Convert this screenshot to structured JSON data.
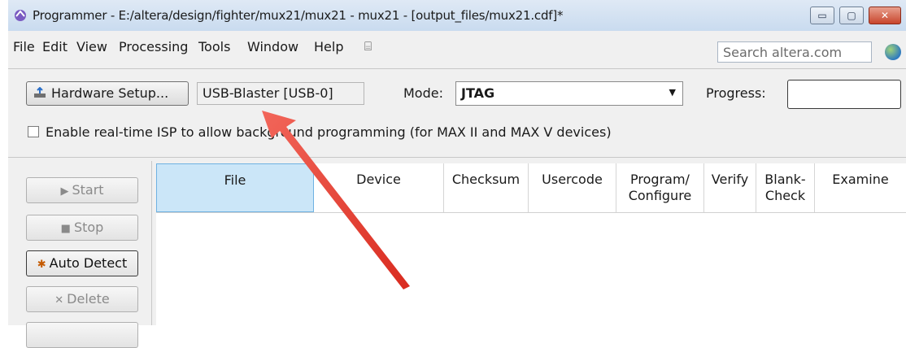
{
  "window": {
    "title": "Programmer - E:/altera/design/fighter/mux21/mux21 - mux21 - [output_files/mux21.cdf]*",
    "minimize": "▭",
    "maximize": "▢",
    "close": "✕"
  },
  "menu": {
    "items": [
      {
        "label": "File"
      },
      {
        "label": "Edit"
      },
      {
        "label": "View"
      },
      {
        "label": "Processing"
      },
      {
        "label": "Tools"
      },
      {
        "label": "Window"
      },
      {
        "label": "Help"
      }
    ],
    "search_placeholder": "Search altera.com"
  },
  "toolbar": {
    "hardware_setup_label": "Hardware Setup...",
    "hardware_value": "USB-Blaster [USB-0]",
    "mode_label": "Mode:",
    "mode_value": "JTAG",
    "progress_label": "Progress:",
    "isp_label": "Enable real-time ISP to allow background programming (for MAX II and MAX V devices)",
    "isp_checked": false
  },
  "sidebar": {
    "buttons": [
      {
        "label": "Start"
      },
      {
        "label": "Stop"
      },
      {
        "label": "Auto Detect"
      },
      {
        "label": "Delete"
      }
    ]
  },
  "table": {
    "columns": [
      {
        "label": "File"
      },
      {
        "label": "Device"
      },
      {
        "label": "Checksum"
      },
      {
        "label": "Usercode"
      },
      {
        "label": "Program/\nConfigure"
      },
      {
        "label": "Verify"
      },
      {
        "label": "Blank-\nCheck"
      },
      {
        "label": "Examine"
      }
    ]
  },
  "colors": {
    "annotation_arrow": "#e8392c",
    "selected_header": "#cbe6f8"
  }
}
